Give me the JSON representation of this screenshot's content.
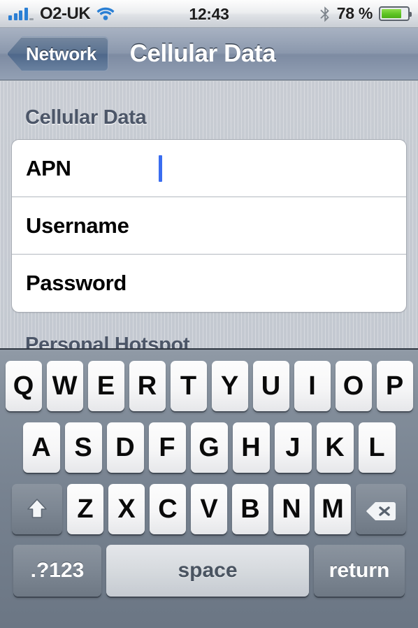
{
  "status_bar": {
    "carrier": "O2-UK",
    "signal_icon": "signal-bars-icon",
    "signal_bars_filled": 4,
    "wifi_icon": "wifi-icon",
    "time": "12:43",
    "bluetooth_icon": "bluetooth-icon",
    "battery_percent": "78 %",
    "battery_level": 78,
    "battery_icon": "battery-icon",
    "accent_blue": "#2a7fd4",
    "battery_green": "#5ec423"
  },
  "nav_bar": {
    "back_label": "Network",
    "title": "Cellular Data"
  },
  "content": {
    "section_header": "Cellular Data",
    "rows": [
      {
        "label": "APN",
        "value": "",
        "has_caret": true
      },
      {
        "label": "Username",
        "value": "",
        "has_caret": false
      },
      {
        "label": "Password",
        "value": "",
        "has_caret": false
      }
    ],
    "next_section_header": "Personal Hotspot",
    "caret_color": "#3a6df0"
  },
  "keyboard": {
    "row1": [
      "Q",
      "W",
      "E",
      "R",
      "T",
      "Y",
      "U",
      "I",
      "O",
      "P"
    ],
    "row2": [
      "A",
      "S",
      "D",
      "F",
      "G",
      "H",
      "J",
      "K",
      "L"
    ],
    "row3_letters": [
      "Z",
      "X",
      "C",
      "V",
      "B",
      "N",
      "M"
    ],
    "shift_icon": "shift-arrow-icon",
    "delete_icon": "backspace-delete-icon",
    "numeric_label": ".?123",
    "space_label": "space",
    "return_label": "return"
  }
}
